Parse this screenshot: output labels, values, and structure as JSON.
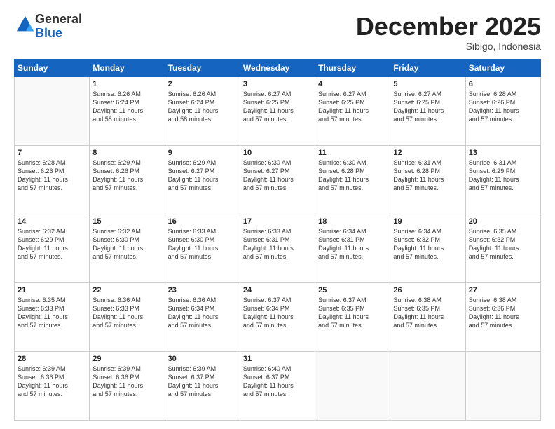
{
  "logo": {
    "general": "General",
    "blue": "Blue"
  },
  "header": {
    "month": "December 2025",
    "location": "Sibigo, Indonesia"
  },
  "weekdays": [
    "Sunday",
    "Monday",
    "Tuesday",
    "Wednesday",
    "Thursday",
    "Friday",
    "Saturday"
  ],
  "weeks": [
    [
      {
        "day": "",
        "info": ""
      },
      {
        "day": "1",
        "info": "Sunrise: 6:26 AM\nSunset: 6:24 PM\nDaylight: 11 hours\nand 58 minutes."
      },
      {
        "day": "2",
        "info": "Sunrise: 6:26 AM\nSunset: 6:24 PM\nDaylight: 11 hours\nand 58 minutes."
      },
      {
        "day": "3",
        "info": "Sunrise: 6:27 AM\nSunset: 6:25 PM\nDaylight: 11 hours\nand 57 minutes."
      },
      {
        "day": "4",
        "info": "Sunrise: 6:27 AM\nSunset: 6:25 PM\nDaylight: 11 hours\nand 57 minutes."
      },
      {
        "day": "5",
        "info": "Sunrise: 6:27 AM\nSunset: 6:25 PM\nDaylight: 11 hours\nand 57 minutes."
      },
      {
        "day": "6",
        "info": "Sunrise: 6:28 AM\nSunset: 6:26 PM\nDaylight: 11 hours\nand 57 minutes."
      }
    ],
    [
      {
        "day": "7",
        "info": "Sunrise: 6:28 AM\nSunset: 6:26 PM\nDaylight: 11 hours\nand 57 minutes."
      },
      {
        "day": "8",
        "info": "Sunrise: 6:29 AM\nSunset: 6:26 PM\nDaylight: 11 hours\nand 57 minutes."
      },
      {
        "day": "9",
        "info": "Sunrise: 6:29 AM\nSunset: 6:27 PM\nDaylight: 11 hours\nand 57 minutes."
      },
      {
        "day": "10",
        "info": "Sunrise: 6:30 AM\nSunset: 6:27 PM\nDaylight: 11 hours\nand 57 minutes."
      },
      {
        "day": "11",
        "info": "Sunrise: 6:30 AM\nSunset: 6:28 PM\nDaylight: 11 hours\nand 57 minutes."
      },
      {
        "day": "12",
        "info": "Sunrise: 6:31 AM\nSunset: 6:28 PM\nDaylight: 11 hours\nand 57 minutes."
      },
      {
        "day": "13",
        "info": "Sunrise: 6:31 AM\nSunset: 6:29 PM\nDaylight: 11 hours\nand 57 minutes."
      }
    ],
    [
      {
        "day": "14",
        "info": "Sunrise: 6:32 AM\nSunset: 6:29 PM\nDaylight: 11 hours\nand 57 minutes."
      },
      {
        "day": "15",
        "info": "Sunrise: 6:32 AM\nSunset: 6:30 PM\nDaylight: 11 hours\nand 57 minutes."
      },
      {
        "day": "16",
        "info": "Sunrise: 6:33 AM\nSunset: 6:30 PM\nDaylight: 11 hours\nand 57 minutes."
      },
      {
        "day": "17",
        "info": "Sunrise: 6:33 AM\nSunset: 6:31 PM\nDaylight: 11 hours\nand 57 minutes."
      },
      {
        "day": "18",
        "info": "Sunrise: 6:34 AM\nSunset: 6:31 PM\nDaylight: 11 hours\nand 57 minutes."
      },
      {
        "day": "19",
        "info": "Sunrise: 6:34 AM\nSunset: 6:32 PM\nDaylight: 11 hours\nand 57 minutes."
      },
      {
        "day": "20",
        "info": "Sunrise: 6:35 AM\nSunset: 6:32 PM\nDaylight: 11 hours\nand 57 minutes."
      }
    ],
    [
      {
        "day": "21",
        "info": "Sunrise: 6:35 AM\nSunset: 6:33 PM\nDaylight: 11 hours\nand 57 minutes."
      },
      {
        "day": "22",
        "info": "Sunrise: 6:36 AM\nSunset: 6:33 PM\nDaylight: 11 hours\nand 57 minutes."
      },
      {
        "day": "23",
        "info": "Sunrise: 6:36 AM\nSunset: 6:34 PM\nDaylight: 11 hours\nand 57 minutes."
      },
      {
        "day": "24",
        "info": "Sunrise: 6:37 AM\nSunset: 6:34 PM\nDaylight: 11 hours\nand 57 minutes."
      },
      {
        "day": "25",
        "info": "Sunrise: 6:37 AM\nSunset: 6:35 PM\nDaylight: 11 hours\nand 57 minutes."
      },
      {
        "day": "26",
        "info": "Sunrise: 6:38 AM\nSunset: 6:35 PM\nDaylight: 11 hours\nand 57 minutes."
      },
      {
        "day": "27",
        "info": "Sunrise: 6:38 AM\nSunset: 6:36 PM\nDaylight: 11 hours\nand 57 minutes."
      }
    ],
    [
      {
        "day": "28",
        "info": "Sunrise: 6:39 AM\nSunset: 6:36 PM\nDaylight: 11 hours\nand 57 minutes."
      },
      {
        "day": "29",
        "info": "Sunrise: 6:39 AM\nSunset: 6:36 PM\nDaylight: 11 hours\nand 57 minutes."
      },
      {
        "day": "30",
        "info": "Sunrise: 6:39 AM\nSunset: 6:37 PM\nDaylight: 11 hours\nand 57 minutes."
      },
      {
        "day": "31",
        "info": "Sunrise: 6:40 AM\nSunset: 6:37 PM\nDaylight: 11 hours\nand 57 minutes."
      },
      {
        "day": "",
        "info": ""
      },
      {
        "day": "",
        "info": ""
      },
      {
        "day": "",
        "info": ""
      }
    ]
  ]
}
